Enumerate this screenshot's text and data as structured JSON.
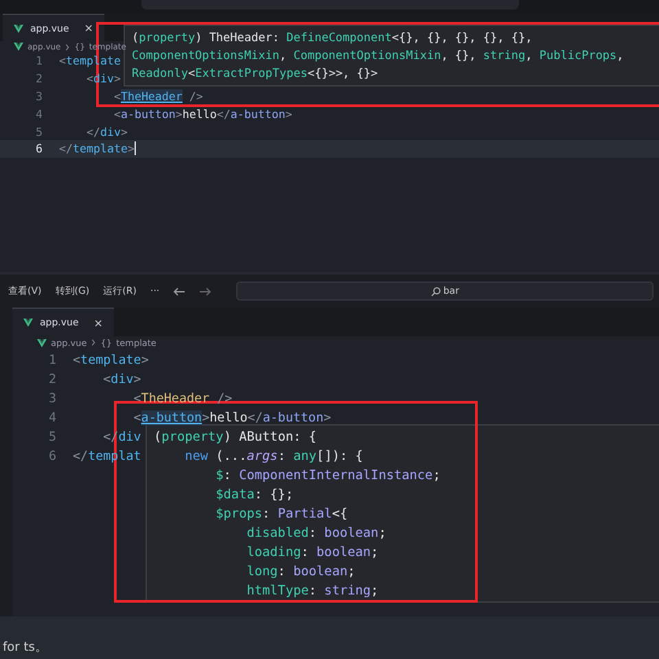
{
  "top_editor": {
    "tab": {
      "label": "app.vue",
      "close": "×",
      "selected": true
    },
    "breadcrumb": {
      "file": "app.vue",
      "symbol": "{}",
      "item": "template"
    },
    "lines": [
      {
        "number": "1",
        "current": false,
        "tokens": [
          {
            "text": "<",
            "kind": "punct"
          },
          {
            "text": "template",
            "kind": "tag"
          }
        ],
        "children": [
          {
            "number": "2",
            "current": false,
            "tokens": [
              {
                "text": "<",
                "kind": "punct"
              },
              {
                "text": "div",
                "kind": "tag"
              },
              {
                "text": ">",
                "kind": "punct"
              }
            ],
            "children": [
              {
                "number": "3",
                "current": false,
                "tokens": [
                  {
                    "text": "<",
                    "kind": "punct"
                  },
                  {
                    "text": "TheHeader",
                    "kind": "link"
                  },
                  {
                    "text": " />",
                    "kind": "punct"
                  }
                ]
              },
              {
                "number": "4",
                "current": false,
                "tokens": [
                  {
                    "text": "<",
                    "kind": "punct"
                  },
                  {
                    "text": "a-button",
                    "kind": "custom"
                  },
                  {
                    "text": ">",
                    "kind": "punct"
                  },
                  {
                    "text": "hello",
                    "kind": "text"
                  },
                  {
                    "text": "</",
                    "kind": "punct"
                  },
                  {
                    "text": "a-button",
                    "kind": "custom"
                  },
                  {
                    "text": ">",
                    "kind": "punct"
                  }
                ]
              }
            ]
          },
          {
            "number": "5",
            "current": false,
            "tokens": [
              {
                "text": "</",
                "kind": "punct"
              },
              {
                "text": "div",
                "kind": "tag"
              },
              {
                "text": ">",
                "kind": "punct"
              }
            ]
          }
        ]
      },
      {
        "number": "6",
        "current": true,
        "tokens": [
          {
            "text": "</",
            "kind": "punct"
          },
          {
            "text": "template",
            "kind": "tag"
          },
          {
            "text": ">",
            "kind": "punct"
          }
        ]
      }
    ],
    "hover": [
      {
        "tokens": [
          {
            "text": "(",
            "kind": "plain"
          },
          {
            "text": "property",
            "kind": "green"
          },
          {
            "text": ") TheHeader: ",
            "kind": "plain"
          },
          {
            "text": "DefineComponent",
            "kind": "green"
          },
          {
            "text": "<{}, {}, {}, {}, {},",
            "kind": "plain"
          }
        ]
      },
      {
        "tokens": [
          {
            "text": "ComponentOptionsMixin",
            "kind": "green"
          },
          {
            "text": ", ",
            "kind": "plain"
          },
          {
            "text": "ComponentOptionsMixin",
            "kind": "green"
          },
          {
            "text": ", {}, ",
            "kind": "plain"
          },
          {
            "text": "string",
            "kind": "green"
          },
          {
            "text": ", ",
            "kind": "plain"
          },
          {
            "text": "PublicProps",
            "kind": "green"
          },
          {
            "text": ",",
            "kind": "plain"
          }
        ]
      },
      {
        "tokens": [
          {
            "text": "Readonly",
            "kind": "green"
          },
          {
            "text": "<",
            "kind": "plain"
          },
          {
            "text": "ExtractPropTypes",
            "kind": "green"
          },
          {
            "text": "<{}>>, {}>",
            "kind": "plain"
          }
        ]
      }
    ]
  },
  "bottom_editor": {
    "menu": [
      "查看(V)",
      "转到(G)",
      "运行(R)",
      "···"
    ],
    "search": {
      "value": "bar"
    },
    "tab": {
      "label": "app.vue",
      "close": "×",
      "selected": true
    },
    "breadcrumb": {
      "file": "app.vue",
      "symbol": "{}",
      "item": "template"
    },
    "lines": [
      {
        "number": "1",
        "tokens": [
          {
            "text": "<",
            "kind": "punct"
          },
          {
            "text": "template",
            "kind": "tag"
          },
          {
            "text": ">",
            "kind": "punct"
          }
        ],
        "children": [
          {
            "number": "2",
            "tokens": [
              {
                "text": "<",
                "kind": "punct"
              },
              {
                "text": "div",
                "kind": "tag"
              },
              {
                "text": ">",
                "kind": "punct"
              }
            ],
            "children": [
              {
                "number": "3",
                "tokens": [
                  {
                    "text": "<",
                    "kind": "punct"
                  },
                  {
                    "text": "TheHeader",
                    "kind": "component"
                  },
                  {
                    "text": " />",
                    "kind": "punct"
                  }
                ]
              },
              {
                "number": "4",
                "tokens": [
                  {
                    "text": "<",
                    "kind": "punct"
                  },
                  {
                    "text": "a-button",
                    "kind": "link"
                  },
                  {
                    "text": ">",
                    "kind": "punct"
                  },
                  {
                    "text": "hello",
                    "kind": "text"
                  },
                  {
                    "text": "</",
                    "kind": "punct"
                  },
                  {
                    "text": "a-button",
                    "kind": "custom"
                  },
                  {
                    "text": ">",
                    "kind": "punct"
                  }
                ]
              }
            ]
          },
          {
            "number": "5",
            "tokens": [
              {
                "text": "</",
                "kind": "punct"
              },
              {
                "text": "div",
                "kind": "tag"
              }
            ]
          }
        ]
      },
      {
        "number": "6",
        "tokens": [
          {
            "text": "</",
            "kind": "punct"
          },
          {
            "text": "templat",
            "kind": "tag"
          }
        ]
      }
    ],
    "hover": [
      {
        "tokens": [
          {
            "text": "(",
            "kind": "plain"
          },
          {
            "text": "property",
            "kind": "green"
          },
          {
            "text": ") AButton: {",
            "kind": "plain"
          }
        ],
        "children": [
          {
            "tokens": [
              {
                "text": "new",
                "kind": "blue"
              },
              {
                "text": " (...",
                "kind": "plain"
              },
              {
                "text": "args",
                "kind": "param"
              },
              {
                "text": ": ",
                "kind": "plain"
              },
              {
                "text": "any",
                "kind": "green"
              },
              {
                "text": "[]): {",
                "kind": "plain"
              }
            ],
            "children": [
              {
                "tokens": [
                  {
                    "text": "$",
                    "kind": "green"
                  },
                  {
                    "text": ": ",
                    "kind": "plain"
                  },
                  {
                    "text": "ComponentInternalInstance",
                    "kind": "type"
                  },
                  {
                    "text": ";",
                    "kind": "plain"
                  }
                ]
              },
              {
                "tokens": [
                  {
                    "text": "$data",
                    "kind": "green"
                  },
                  {
                    "text": ": {};",
                    "kind": "plain"
                  }
                ]
              },
              {
                "tokens": [
                  {
                    "text": "$props",
                    "kind": "green"
                  },
                  {
                    "text": ": ",
                    "kind": "plain"
                  },
                  {
                    "text": "Partial",
                    "kind": "type"
                  },
                  {
                    "text": "<{",
                    "kind": "plain"
                  }
                ],
                "children": [
                  {
                    "tokens": [
                      {
                        "text": "disabled",
                        "kind": "green"
                      },
                      {
                        "text": ": ",
                        "kind": "plain"
                      },
                      {
                        "text": "boolean",
                        "kind": "type"
                      },
                      {
                        "text": ";",
                        "kind": "plain"
                      }
                    ]
                  },
                  {
                    "tokens": [
                      {
                        "text": "loading",
                        "kind": "green"
                      },
                      {
                        "text": ": ",
                        "kind": "plain"
                      },
                      {
                        "text": "boolean",
                        "kind": "type"
                      },
                      {
                        "text": ";",
                        "kind": "plain"
                      }
                    ]
                  },
                  {
                    "tokens": [
                      {
                        "text": "long",
                        "kind": "green"
                      },
                      {
                        "text": ": ",
                        "kind": "plain"
                      },
                      {
                        "text": "boolean",
                        "kind": "type"
                      },
                      {
                        "text": ";",
                        "kind": "plain"
                      }
                    ]
                  },
                  {
                    "tokens": [
                      {
                        "text": "htmlType",
                        "kind": "green"
                      },
                      {
                        "text": ": ",
                        "kind": "plain"
                      },
                      {
                        "text": "string",
                        "kind": "type"
                      },
                      {
                        "text": ";",
                        "kind": "plain"
                      }
                    ]
                  }
                ]
              }
            ]
          }
        ]
      }
    ]
  },
  "caption": "for ts。"
}
